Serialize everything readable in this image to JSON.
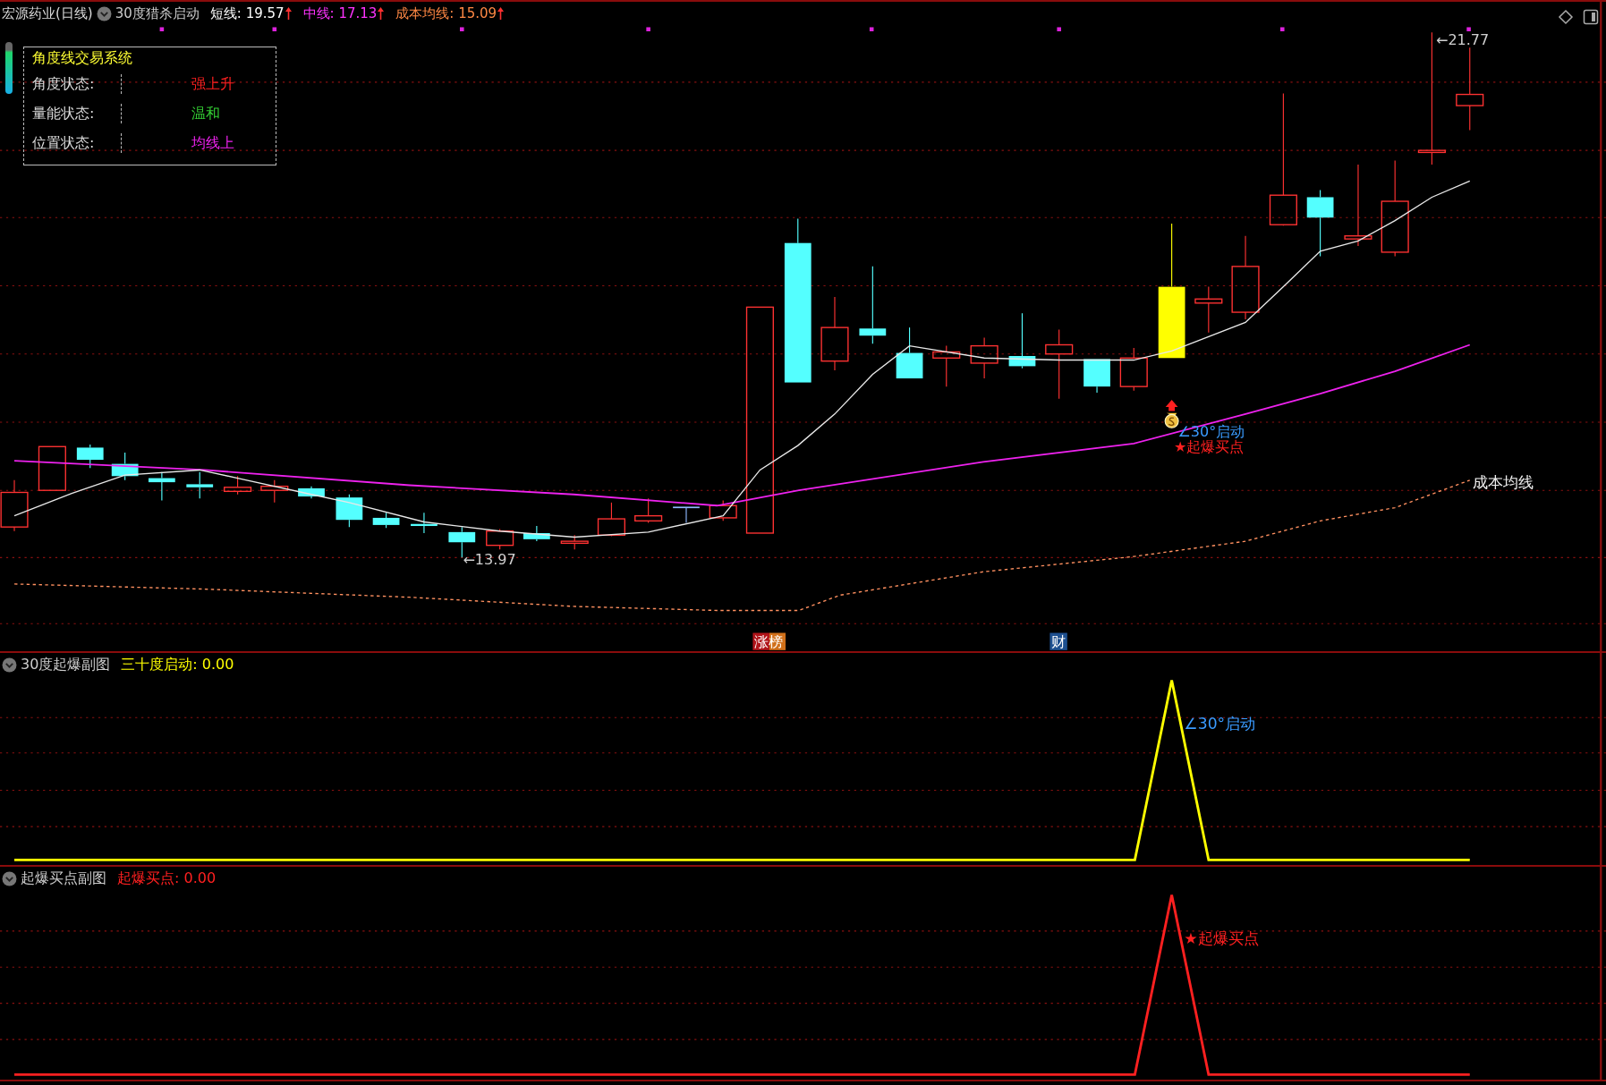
{
  "header": {
    "title": "宏源药业(日线)",
    "indicator": "30度猎杀启动",
    "lines": [
      {
        "label": "短线:",
        "value": "19.57",
        "color": "#ffffff"
      },
      {
        "label": "中线:",
        "value": "17.13",
        "color": "#ff33ff"
      },
      {
        "label": "成本均线:",
        "value": "15.09",
        "color": "#ff8844"
      }
    ]
  },
  "legend": {
    "title": "角度线交易系统",
    "rows": [
      {
        "label": "角度状态:",
        "value": "强上升",
        "color": "#ff2020"
      },
      {
        "label": "量能状态:",
        "value": "温和",
        "color": "#33cc33"
      },
      {
        "label": "位置状态:",
        "value": "均线上",
        "color": "#ee22ee"
      }
    ]
  },
  "chart_labels": {
    "high": "←21.77",
    "low": "←13.97",
    "cost_line": "成本均线",
    "signal_start": "∠30°启动",
    "signal_buy": "★起爆买点"
  },
  "badges": [
    {
      "text": "涨榜"
    },
    {
      "text": "财"
    }
  ],
  "subcharts": [
    {
      "title": "30度起爆副图",
      "series_label": "三十度启动:",
      "value": "0.00",
      "color": "#ffff00",
      "annotation": "∠30°启动"
    },
    {
      "title": "起爆买点副图",
      "series_label": "起爆买点:",
      "value": "0.00",
      "color": "#ff2020",
      "annotation": "★起爆买点"
    }
  ]
}
